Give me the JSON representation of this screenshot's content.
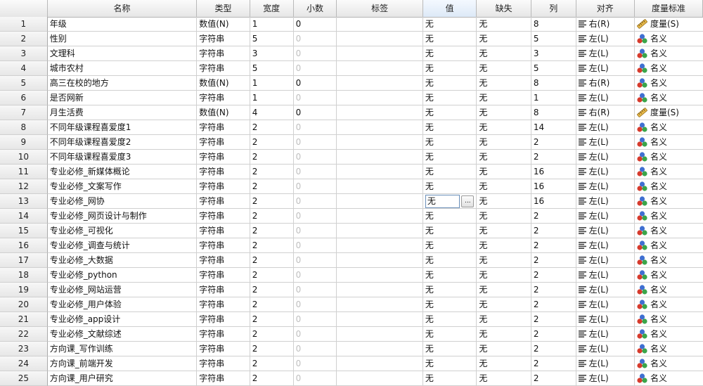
{
  "headers": [
    "",
    "名称",
    "类型",
    "宽度",
    "小数",
    "标签",
    "值",
    "缺失",
    "列",
    "对齐",
    "度量标准"
  ],
  "selected_column": "值",
  "rows": [
    {
      "num": "1",
      "name": "年级",
      "type": "数值(N)",
      "width": "1",
      "decimals": "0",
      "label": "",
      "values": "无",
      "missing": "无",
      "columns": "8",
      "align": "右(R)",
      "measure": "度量(S)"
    },
    {
      "num": "2",
      "name": "性别",
      "type": "字符串",
      "width": "5",
      "decimals": "0",
      "label": "",
      "values": "无",
      "missing": "无",
      "columns": "5",
      "align": "左(L)",
      "measure": "名义"
    },
    {
      "num": "3",
      "name": "文理科",
      "type": "字符串",
      "width": "3",
      "decimals": "0",
      "label": "",
      "values": "无",
      "missing": "无",
      "columns": "3",
      "align": "左(L)",
      "measure": "名义"
    },
    {
      "num": "4",
      "name": "城市农村",
      "type": "字符串",
      "width": "5",
      "decimals": "0",
      "label": "",
      "values": "无",
      "missing": "无",
      "columns": "5",
      "align": "左(L)",
      "measure": "名义"
    },
    {
      "num": "5",
      "name": "高三在校的地方",
      "type": "数值(N)",
      "width": "1",
      "decimals": "0",
      "label": "",
      "values": "无",
      "missing": "无",
      "columns": "8",
      "align": "右(R)",
      "measure": "名义"
    },
    {
      "num": "6",
      "name": "是否网新",
      "type": "字符串",
      "width": "1",
      "decimals": "0",
      "label": "",
      "values": "无",
      "missing": "无",
      "columns": "1",
      "align": "左(L)",
      "measure": "名义"
    },
    {
      "num": "7",
      "name": "月生活费",
      "type": "数值(N)",
      "width": "4",
      "decimals": "0",
      "label": "",
      "values": "无",
      "missing": "无",
      "columns": "8",
      "align": "右(R)",
      "measure": "度量(S)"
    },
    {
      "num": "8",
      "name": "不同年级课程喜爱度1",
      "type": "字符串",
      "width": "2",
      "decimals": "0",
      "label": "",
      "values": "无",
      "missing": "无",
      "columns": "14",
      "align": "左(L)",
      "measure": "名义"
    },
    {
      "num": "9",
      "name": "不同年级课程喜爱度2",
      "type": "字符串",
      "width": "2",
      "decimals": "0",
      "label": "",
      "values": "无",
      "missing": "无",
      "columns": "2",
      "align": "左(L)",
      "measure": "名义"
    },
    {
      "num": "10",
      "name": "不同年级课程喜爱度3",
      "type": "字符串",
      "width": "2",
      "decimals": "0",
      "label": "",
      "values": "无",
      "missing": "无",
      "columns": "2",
      "align": "左(L)",
      "measure": "名义"
    },
    {
      "num": "11",
      "name": "专业必修_新媒体概论",
      "type": "字符串",
      "width": "2",
      "decimals": "0",
      "label": "",
      "values": "无",
      "missing": "无",
      "columns": "16",
      "align": "左(L)",
      "measure": "名义"
    },
    {
      "num": "12",
      "name": "专业必修_文案写作",
      "type": "字符串",
      "width": "2",
      "decimals": "0",
      "label": "",
      "values": "无",
      "missing": "无",
      "columns": "16",
      "align": "左(L)",
      "measure": "名义"
    },
    {
      "num": "13",
      "name": "专业必修_网协",
      "type": "字符串",
      "width": "2",
      "decimals": "0",
      "label": "",
      "values": "无",
      "missing": "无",
      "columns": "16",
      "align": "左(L)",
      "measure": "名义",
      "editing": true
    },
    {
      "num": "14",
      "name": "专业必修_网页设计与制作",
      "type": "字符串",
      "width": "2",
      "decimals": "0",
      "label": "",
      "values": "无",
      "missing": "无",
      "columns": "2",
      "align": "左(L)",
      "measure": "名义"
    },
    {
      "num": "15",
      "name": "专业必修_可视化",
      "type": "字符串",
      "width": "2",
      "decimals": "0",
      "label": "",
      "values": "无",
      "missing": "无",
      "columns": "2",
      "align": "左(L)",
      "measure": "名义"
    },
    {
      "num": "16",
      "name": "专业必修_调查与统计",
      "type": "字符串",
      "width": "2",
      "decimals": "0",
      "label": "",
      "values": "无",
      "missing": "无",
      "columns": "2",
      "align": "左(L)",
      "measure": "名义"
    },
    {
      "num": "17",
      "name": "专业必修_大数据",
      "type": "字符串",
      "width": "2",
      "decimals": "0",
      "label": "",
      "values": "无",
      "missing": "无",
      "columns": "2",
      "align": "左(L)",
      "measure": "名义"
    },
    {
      "num": "18",
      "name": "专业必修_python",
      "type": "字符串",
      "width": "2",
      "decimals": "0",
      "label": "",
      "values": "无",
      "missing": "无",
      "columns": "2",
      "align": "左(L)",
      "measure": "名义"
    },
    {
      "num": "19",
      "name": "专业必修_网站运营",
      "type": "字符串",
      "width": "2",
      "decimals": "0",
      "label": "",
      "values": "无",
      "missing": "无",
      "columns": "2",
      "align": "左(L)",
      "measure": "名义"
    },
    {
      "num": "20",
      "name": "专业必修_用户体验",
      "type": "字符串",
      "width": "2",
      "decimals": "0",
      "label": "",
      "values": "无",
      "missing": "无",
      "columns": "2",
      "align": "左(L)",
      "measure": "名义"
    },
    {
      "num": "21",
      "name": "专业必修_app设计",
      "type": "字符串",
      "width": "2",
      "decimals": "0",
      "label": "",
      "values": "无",
      "missing": "无",
      "columns": "2",
      "align": "左(L)",
      "measure": "名义"
    },
    {
      "num": "22",
      "name": "专业必修_文献综述",
      "type": "字符串",
      "width": "2",
      "decimals": "0",
      "label": "",
      "values": "无",
      "missing": "无",
      "columns": "2",
      "align": "左(L)",
      "measure": "名义"
    },
    {
      "num": "23",
      "name": "方向课_写作训练",
      "type": "字符串",
      "width": "2",
      "decimals": "0",
      "label": "",
      "values": "无",
      "missing": "无",
      "columns": "2",
      "align": "左(L)",
      "measure": "名义"
    },
    {
      "num": "24",
      "name": "方向课_前端开发",
      "type": "字符串",
      "width": "2",
      "decimals": "0",
      "label": "",
      "values": "无",
      "missing": "无",
      "columns": "2",
      "align": "左(L)",
      "measure": "名义"
    },
    {
      "num": "25",
      "name": "方向课_用户研究",
      "type": "字符串",
      "width": "2",
      "decimals": "0",
      "label": "",
      "values": "无",
      "missing": "无",
      "columns": "2",
      "align": "左(L)",
      "measure": "名义"
    }
  ],
  "editor_button": "...",
  "icons": {
    "align": "align-lines-icon",
    "scale": "ruler-icon",
    "nominal": "nominal-circles-icon"
  },
  "colors": {
    "ruler": "#d9a520",
    "nominal_red": "#d63a2c",
    "nominal_blue": "#3f6fd1",
    "nominal_green": "#3aa54a"
  }
}
